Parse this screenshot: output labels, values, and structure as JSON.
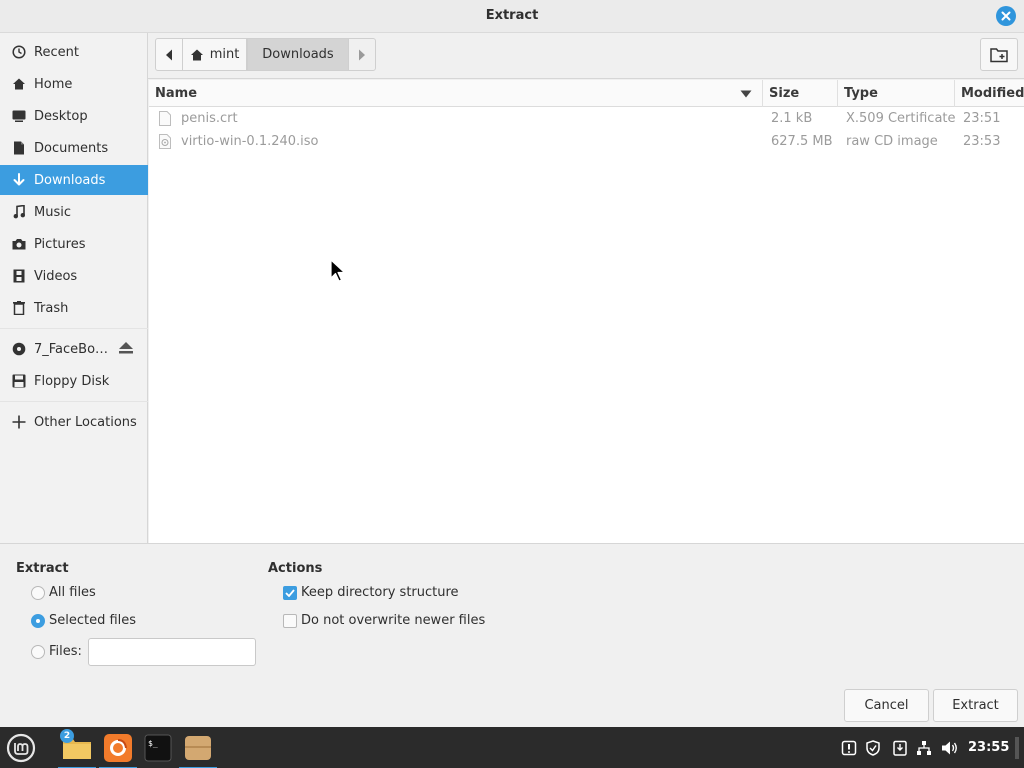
{
  "window": {
    "title": "Extract"
  },
  "sidebar": {
    "items": [
      {
        "label": "Recent",
        "icon": "clock-icon"
      },
      {
        "label": "Home",
        "icon": "home-icon"
      },
      {
        "label": "Desktop",
        "icon": "desktop-icon"
      },
      {
        "label": "Documents",
        "icon": "document-icon"
      },
      {
        "label": "Downloads",
        "icon": "download-icon",
        "active": true
      },
      {
        "label": "Music",
        "icon": "music-icon"
      },
      {
        "label": "Pictures",
        "icon": "camera-icon"
      },
      {
        "label": "Videos",
        "icon": "film-icon"
      },
      {
        "label": "Trash",
        "icon": "trash-icon"
      },
      {
        "label": "7_FaceBo…",
        "icon": "disc-icon",
        "ejectable": true
      },
      {
        "label": "Floppy Disk",
        "icon": "floppy-icon"
      },
      {
        "label": "Other Locations",
        "icon": "plus-icon"
      }
    ]
  },
  "pathbar": {
    "segments": [
      "mint",
      "Downloads"
    ],
    "active_segment": "Downloads"
  },
  "filelist": {
    "columns": [
      "Name",
      "Size",
      "Type",
      "Modified"
    ],
    "rows": [
      {
        "name": "penis.crt",
        "size": "2.1 kB",
        "type": "X.509 Certificate",
        "modified": "23:51",
        "icon": "file-icon"
      },
      {
        "name": "virtio-win-0.1.240.iso",
        "size": "627.5 MB",
        "type": "raw CD image",
        "modified": "23:53",
        "icon": "disc-image-icon"
      }
    ]
  },
  "options": {
    "extract": {
      "heading": "Extract",
      "all_files": "All files",
      "selected_files": "Selected files",
      "files": "Files:",
      "files_value": "",
      "selected": "selected_files"
    },
    "actions": {
      "heading": "Actions",
      "keep_structure": "Keep directory structure",
      "keep_structure_checked": true,
      "no_overwrite": "Do not overwrite newer files",
      "no_overwrite_checked": false
    }
  },
  "buttons": {
    "cancel": "Cancel",
    "extract": "Extract"
  },
  "taskbar": {
    "files_badge": "2",
    "clock": "23:55"
  },
  "colors": {
    "accent": "#3c9de0",
    "taskbar": "#2b2b2b"
  }
}
